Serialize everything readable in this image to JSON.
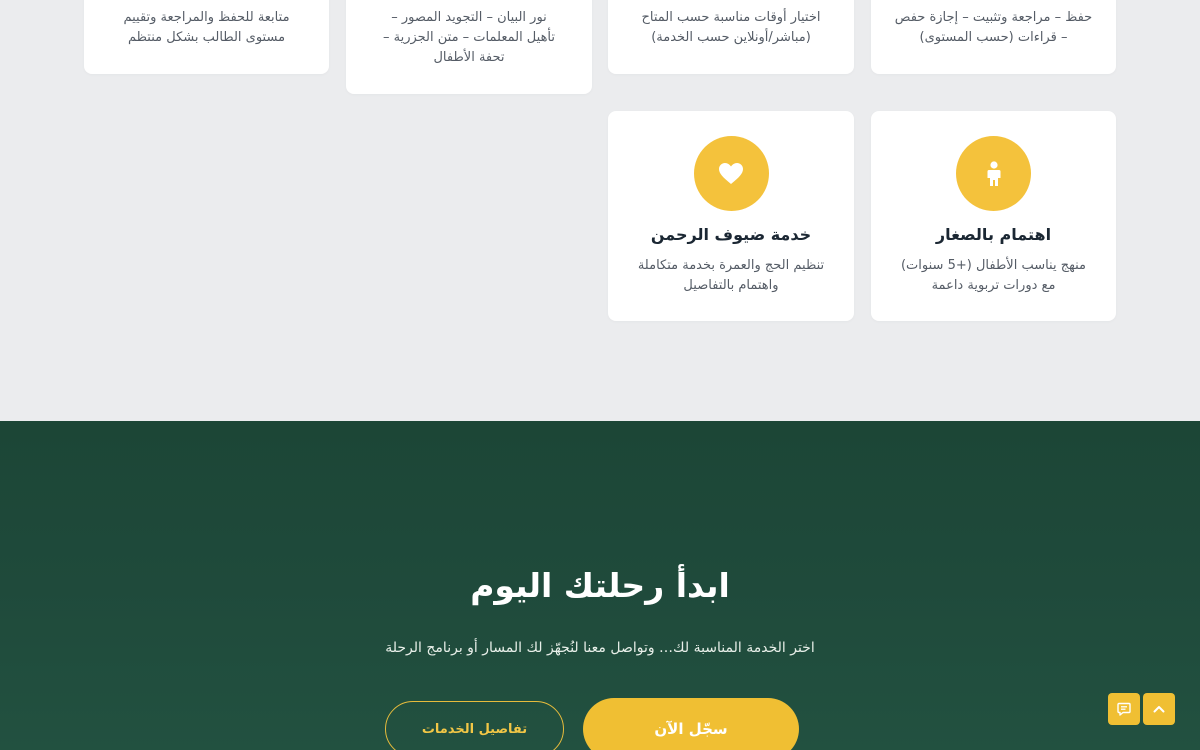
{
  "top_cards": [
    {
      "desc_line1": "حفظ – مراجعة وتثبيت – إجازة حفص",
      "desc_line2": "– قراءات (حسب المستوى)"
    },
    {
      "desc_line1": "اختيار أوقات مناسبة حسب المتاح",
      "desc_line2": "(مباشر/أونلاين حسب الخدمة)"
    },
    {
      "desc_line1": "نور البيان – التجويد المصور –",
      "desc_line2": "تأهيل المعلمات – متن الجزرية –",
      "desc_line3": "تحفة الأطفال"
    },
    {
      "desc_line1": "متابعة للحفظ والمراجعة وتقييم",
      "desc_line2": "مستوى الطالب بشكل منتظم"
    }
  ],
  "bottom_cards": [
    {
      "icon": "child-icon",
      "title": "اهتمام بالصغار",
      "desc_line1": "منهج يناسب الأطفال (+5 سنوات)",
      "desc_line2": "مع دورات تربوية داعمة"
    },
    {
      "icon": "heart-icon",
      "title": "خدمة ضيوف الرحمن",
      "desc_line1": "تنظيم الحج والعمرة بخدمة متكاملة",
      "desc_line2": "واهتمام بالتفاصيل"
    }
  ],
  "cta": {
    "title": "ابدأ رحلتك اليوم",
    "subtitle": "اختر الخدمة المناسبة لك… وتواصل معنا لنُجهّز لك المسار أو برنامج الرحلة",
    "primary_button": "سجّل الآن",
    "secondary_button": "تفاصيل الخدمات"
  },
  "floating": {
    "scroll_top_icon": "chevron-up-icon",
    "chat_icon": "chat-icon"
  },
  "colors": {
    "accent": "#f0bf33",
    "cta_bg": "#1f4a3b",
    "page_bg": "#ebecee"
  }
}
